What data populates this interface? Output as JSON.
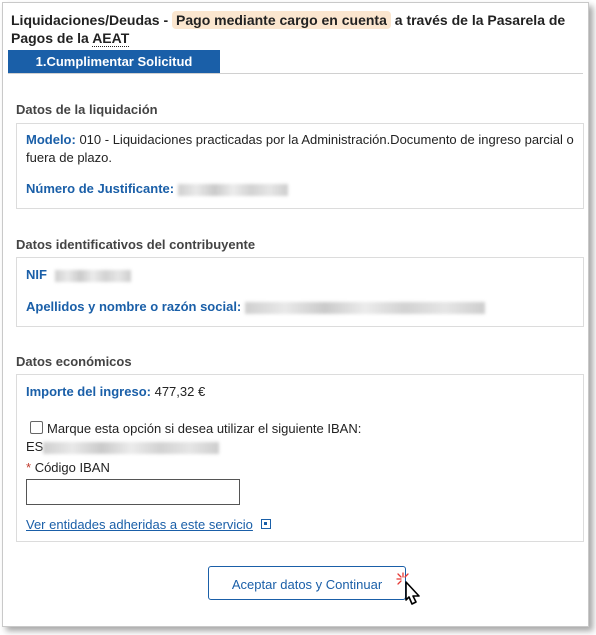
{
  "header": {
    "title_prefix": "Liquidaciones/Deudas - ",
    "title_highlight": "Pago mediante cargo en cuenta",
    "title_suffix": " a través de la Pasarela de Pagos de la ",
    "title_end": "AEAT"
  },
  "step": {
    "label": "1.Cumplimentar Solicitud"
  },
  "liquidacion": {
    "title": "Datos de la liquidación",
    "modelo_label": "Modelo:",
    "modelo_value": "010 - Liquidaciones practicadas por la Administración.Documento de ingreso parcial o fuera de plazo.",
    "justificante_label": "Número de Justificante:"
  },
  "contribuyente": {
    "title": "Datos identificativos del contribuyente",
    "nif_label": "NIF",
    "nombre_label": "Apellidos y nombre o razón social:"
  },
  "economicos": {
    "title": "Datos económicos",
    "importe_label": "Importe del ingreso:",
    "importe_value": "477,32 €",
    "iban_option": "Marque esta opción si desea utilizar el siguiente IBAN:",
    "iban_prefix": "ES",
    "codigo_iban_label": "Código IBAN",
    "required_mark": "*",
    "entidades_link": "Ver entidades adheridas a este servicio"
  },
  "actions": {
    "accept_label": "Aceptar datos y Continuar"
  },
  "colors": {
    "accent": "#1a5fa8",
    "highlight": "#fbe6cf",
    "required": "#c0392b"
  }
}
